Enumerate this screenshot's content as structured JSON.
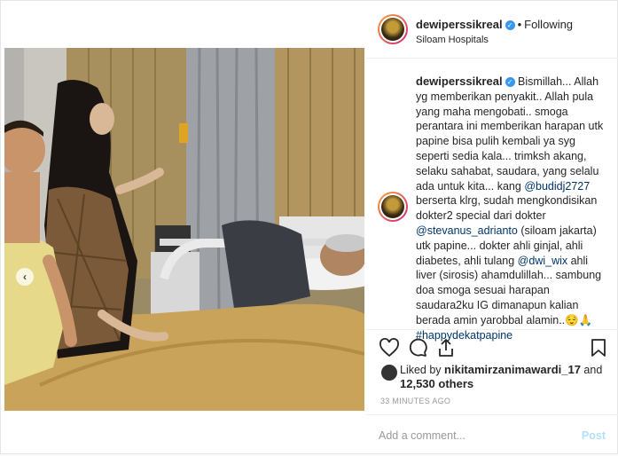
{
  "post": {
    "username": "dewiperssikreal",
    "following_label": "Following",
    "location": "Siloam Hospitals",
    "caption": {
      "author": "dewiperssikreal",
      "text_1": "Bismillah... Allah yg memberikan penyakit.. Allah pula yang maha mengobati.. smoga perantara ini memberikan harapan utk papine bisa pulih kembali ya syg seperti sedia kala... trimksh akang, selaku sahabat, saudara, yang selalu ada untuk kita... kang ",
      "mention_1": "@budidj2727",
      "text_2": " berserta klrg, sudah mengkondisikan dokter2 special dari dokter ",
      "mention_2": "@stevanus_adrianto",
      "text_3": " (siloam jakarta) utk papine... dokter ahli ginjal, ahli diabetes, ahli tulang ",
      "mention_3": "@dwi_wix",
      "text_4": " ahli liver (sirosis) ahamdulillah... sambung doa smoga sesuai harapan saudara2ku IG dimanapun kalian berada amin yarobbal alamin..",
      "emoji": "😌🙏",
      "hashtag": "#happydekatpapine"
    },
    "likes": {
      "prefix": "Liked by ",
      "user": "nikitamirzanimawardi_17",
      "middle": " and",
      "count": "12,530 others"
    },
    "timestamp": "33 MINUTES AGO",
    "comment_placeholder": "Add a comment...",
    "post_button": "Post"
  },
  "carousel": {
    "prev_icon": "‹"
  },
  "colors": {
    "link": "#003569",
    "verified": "#3897f0",
    "post_btn": "#b2dffc"
  }
}
